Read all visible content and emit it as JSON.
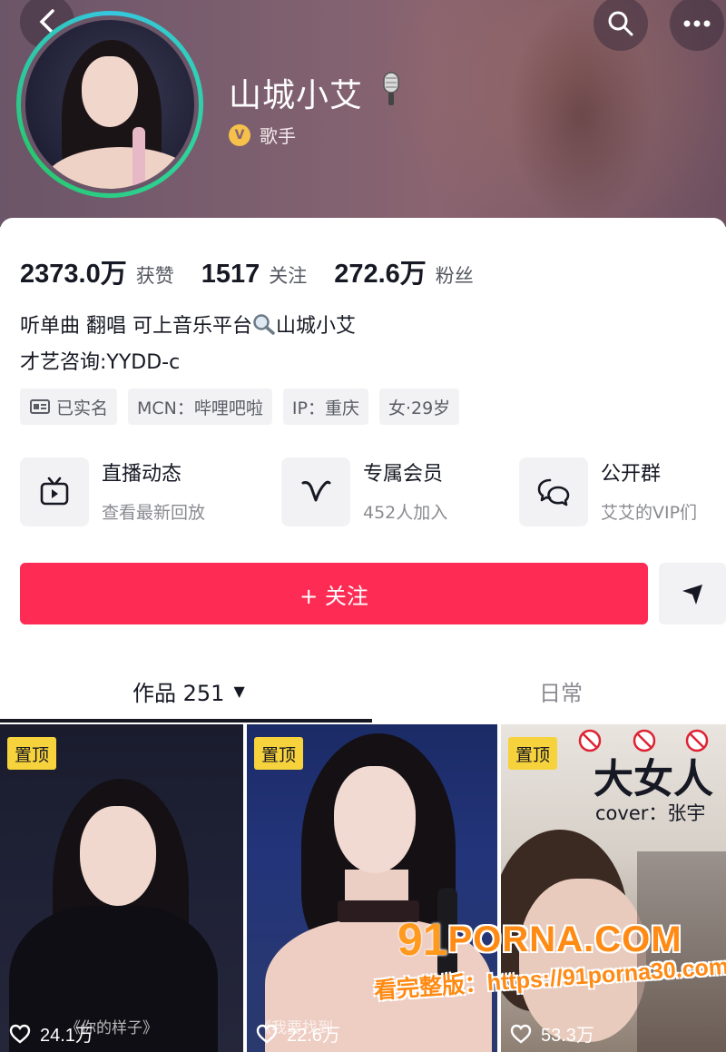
{
  "profile": {
    "name": "山城小艾",
    "verification_label": "歌手"
  },
  "stats": [
    {
      "value": "2373.0万",
      "label": "获赞"
    },
    {
      "value": "1517",
      "label": "关注"
    },
    {
      "value": "272.6万",
      "label": "粉丝"
    }
  ],
  "bio": {
    "line1_prefix": "听单曲 翻唱 可上音乐平台",
    "line1_suffix": "山城小艾",
    "line2": "才艺咨询:YYDD-c"
  },
  "tags": [
    {
      "icon": "id-card-icon",
      "label": "已实名"
    },
    {
      "label": "MCN：哔哩吧啦"
    },
    {
      "label": "IP：重庆"
    },
    {
      "label": "女·29岁"
    }
  ],
  "features": [
    {
      "icon": "tv-play-icon",
      "title": "直播动态",
      "subtitle": "查看最新回放"
    },
    {
      "icon": "v-member-icon",
      "title": "专属会员",
      "subtitle": "452人加入"
    },
    {
      "icon": "chat-bubbles-icon",
      "title": "公开群",
      "subtitle": "艾艾的VIP们"
    }
  ],
  "actions": {
    "follow_label": "+ 关注"
  },
  "tabs": {
    "works_label": "作品 251",
    "daily_label": "日常"
  },
  "videos": [
    {
      "pinned_label": "置顶",
      "likes": "24.1万",
      "caption": "《你的样子》"
    },
    {
      "pinned_label": "置顶",
      "likes": "22.6万",
      "caption": "《我要找到"
    },
    {
      "pinned_label": "置顶",
      "likes": "53.3万",
      "title": "大女人",
      "cover_text": "cover：张宇"
    }
  ],
  "watermark": {
    "logo_prefix": "91",
    "logo_text": "PORNA.COM",
    "url_text": "看完整版：https://91porna30.com"
  },
  "colors": {
    "accent": "#fe2c55",
    "pin_badge": "#f6d23c",
    "verify_badge": "#f5c14b",
    "avatar_ring": "#2fd39a"
  }
}
